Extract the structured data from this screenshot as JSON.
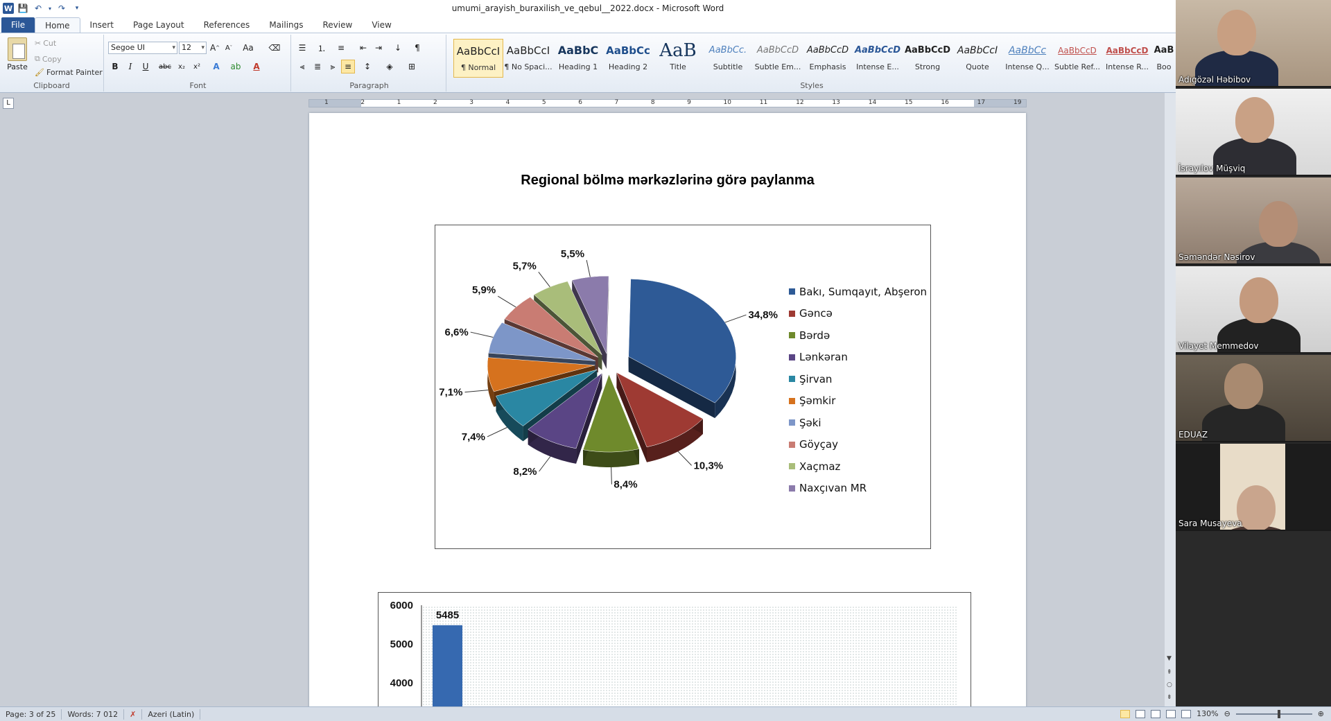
{
  "titlebar": {
    "doc_title": "umumi_arayish_buraxilish_ve_qebul__2022.docx  -  Microsoft Word"
  },
  "tabs": [
    {
      "label": "File"
    },
    {
      "label": "Home"
    },
    {
      "label": "Insert"
    },
    {
      "label": "Page Layout"
    },
    {
      "label": "References"
    },
    {
      "label": "Mailings"
    },
    {
      "label": "Review"
    },
    {
      "label": "View"
    }
  ],
  "ribbon": {
    "clipboard": {
      "paste": "Paste",
      "cut": "Cut",
      "copy": "Copy",
      "format_painter": "Format Painter",
      "label": "Clipboard"
    },
    "font": {
      "name": "Segoe UI",
      "size": "12",
      "label": "Font"
    },
    "paragraph": {
      "label": "Paragraph"
    },
    "styles": {
      "label": "Styles",
      "items": [
        {
          "sample": "AaBbCcI",
          "name": "¶ Normal"
        },
        {
          "sample": "AaBbCcI",
          "name": "¶ No Spaci..."
        },
        {
          "sample": "AaBbC",
          "name": "Heading 1"
        },
        {
          "sample": "AaBbCc",
          "name": "Heading 2"
        },
        {
          "sample": "AaB",
          "name": "Title"
        },
        {
          "sample": "AaBbCc.",
          "name": "Subtitle"
        },
        {
          "sample": "AaBbCcD",
          "name": "Subtle Em..."
        },
        {
          "sample": "AaBbCcD",
          "name": "Emphasis"
        },
        {
          "sample": "AaBbCcD",
          "name": "Intense E..."
        },
        {
          "sample": "AaBbCcD",
          "name": "Strong"
        },
        {
          "sample": "AaBbCcI",
          "name": "Quote"
        },
        {
          "sample": "AaBbCc",
          "name": "Intense Q..."
        },
        {
          "sample": "AaBbCcD",
          "name": "Subtle Ref..."
        },
        {
          "sample": "AaBbCcD",
          "name": "Intense R..."
        },
        {
          "sample": "AaB",
          "name": "Boo"
        }
      ]
    }
  },
  "ruler": {
    "numbers": [
      "1",
      "2",
      "1",
      "2",
      "3",
      "4",
      "5",
      "6",
      "7",
      "8",
      "9",
      "10",
      "11",
      "12",
      "13",
      "14",
      "15",
      "16",
      "17",
      "19"
    ]
  },
  "document": {
    "chart_title": "Regional bölmə mərkəzlərinə görə paylanma"
  },
  "chart_data": [
    {
      "type": "pie",
      "title": "Regional bölmə mərkəzlərinə görə paylanma",
      "legend_position": "right",
      "slices": [
        {
          "name": "Bakı, Sumqayıt, Abşeron",
          "label": "34,8%",
          "value": 34.8,
          "color": "#2e5a96"
        },
        {
          "name": "Gəncə",
          "label": "10,3%",
          "value": 10.3,
          "color": "#9e3a33"
        },
        {
          "name": "Bərdə",
          "label": "8,4%",
          "value": 8.4,
          "color": "#6f8a2c"
        },
        {
          "name": "Lənkəran",
          "label": "8,2%",
          "value": 8.2,
          "color": "#5a4585"
        },
        {
          "name": "Şirvan",
          "label": "7,4%",
          "value": 7.4,
          "color": "#2a87a3"
        },
        {
          "name": "Şəmkir",
          "label": "7,1%",
          "value": 7.1,
          "color": "#d6721e"
        },
        {
          "name": "Şəki",
          "label": "6,6%",
          "value": 6.6,
          "color": "#7d96c8"
        },
        {
          "name": "Göyçay",
          "label": "5,9%",
          "value": 5.9,
          "color": "#c97c73"
        },
        {
          "name": "Xaçmaz",
          "label": "5,7%",
          "value": 5.7,
          "color": "#a9bd7a"
        },
        {
          "name": "Naxçıvan MR",
          "label": "5,5%",
          "value": 5.5,
          "color": "#8b7bab"
        }
      ]
    },
    {
      "type": "bar",
      "ylim": [
        4000,
        6000
      ],
      "y_ticks": [
        "6000",
        "5000",
        "4000"
      ],
      "values": [
        5485
      ],
      "value_labels": [
        "5485"
      ],
      "color": "#3669b0"
    }
  ],
  "statusbar": {
    "page": "Page: 3 of 25",
    "words": "Words: 7 012",
    "language": "Azeri (Latin)",
    "zoom": "130%"
  },
  "participants": [
    {
      "name": "Adıgözəl Həbibov"
    },
    {
      "name": "İsrayılov Müşviq"
    },
    {
      "name": "Səməndər Nəsirov"
    },
    {
      "name": "Vilayet Memmedov"
    },
    {
      "name": "EDUAZ"
    },
    {
      "name": "Sara Musayeva"
    }
  ],
  "colors": {
    "word_blue": "#2b5797",
    "selection": "#fde8a4"
  }
}
